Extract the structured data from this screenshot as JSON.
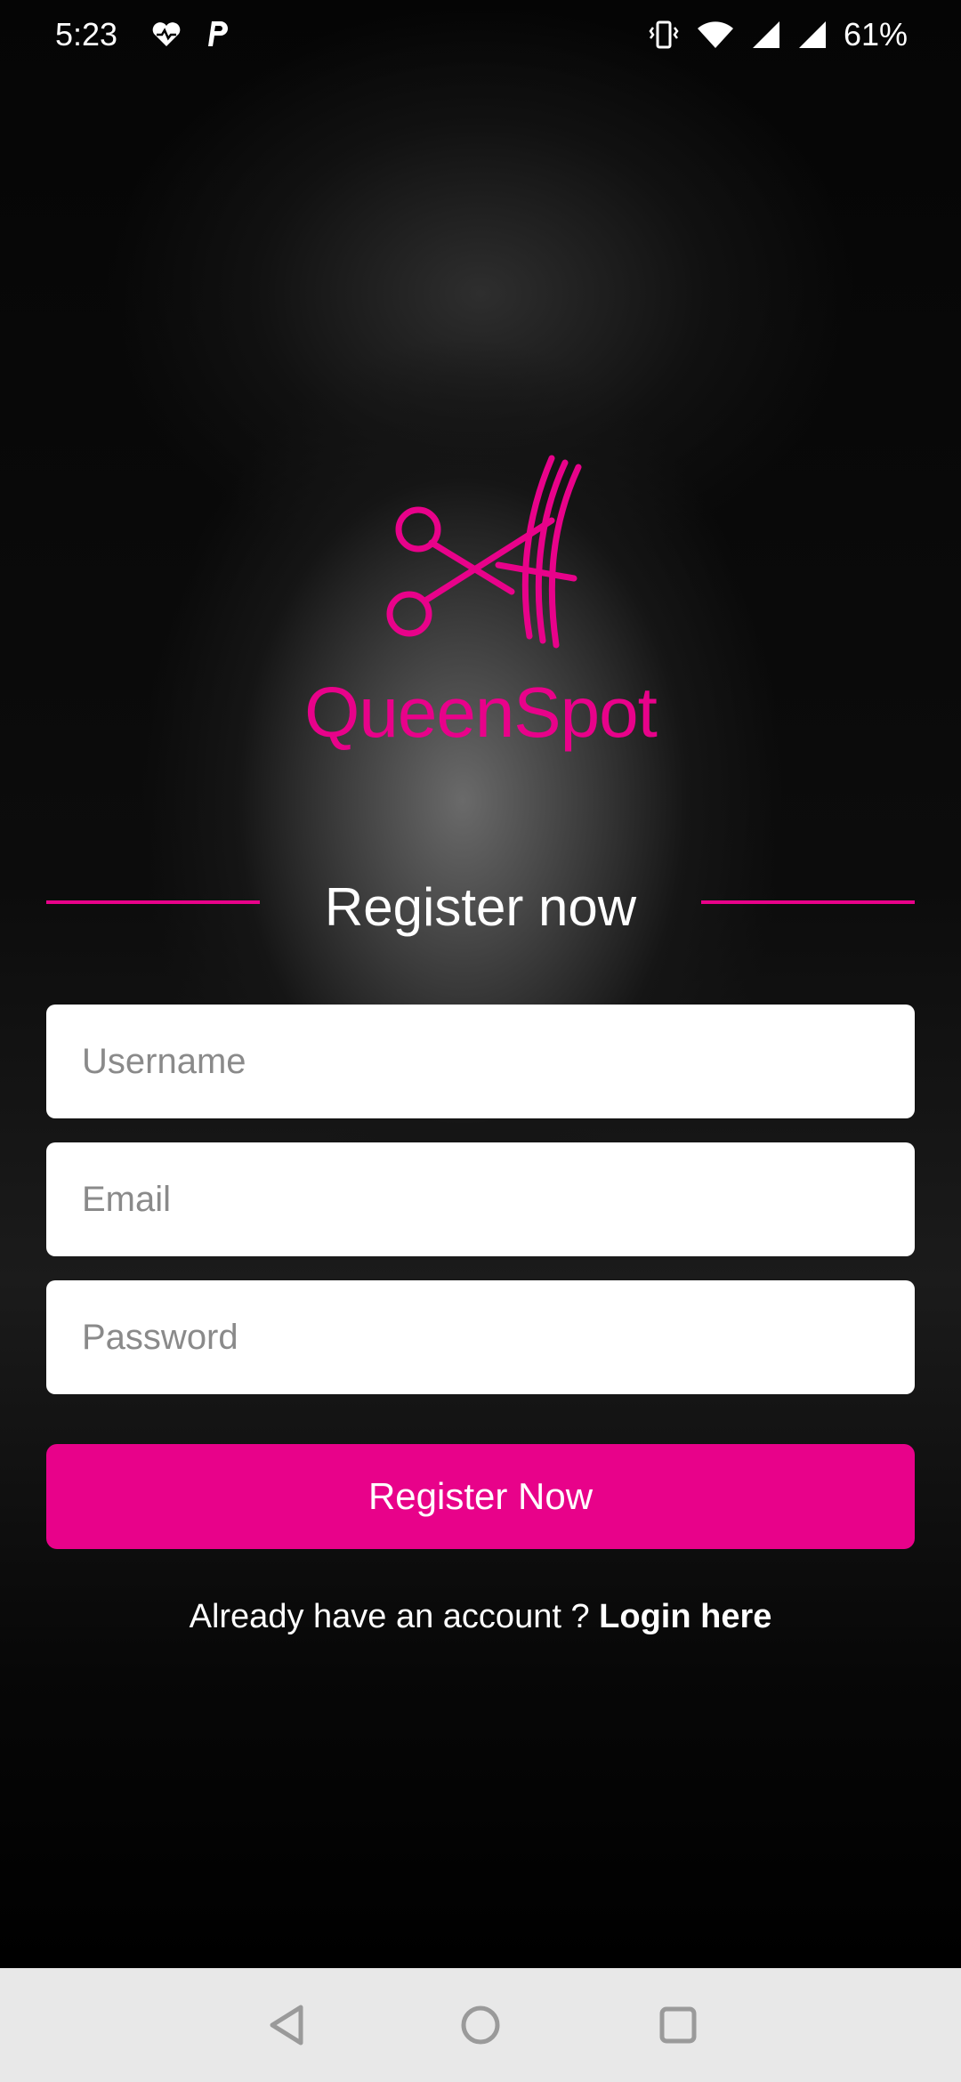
{
  "status_bar": {
    "time": "5:23",
    "battery": "61%",
    "icons": [
      "heart-pulse-icon",
      "p-icon",
      "vibrate-icon",
      "wifi-icon",
      "signal-icon",
      "signal-icon",
      "battery-text"
    ]
  },
  "brand": {
    "name": "QueenSpot",
    "logo_icon": "scissors-comb-icon",
    "accent_color": "#e8028a"
  },
  "register": {
    "heading": "Register now",
    "username_placeholder": "Username",
    "email_placeholder": "Email",
    "password_placeholder": "Password",
    "button_label": "Register Now",
    "login_prompt": "Already have an account ?",
    "login_link": "Login here"
  },
  "nav_bar": {
    "icons": [
      "back-icon",
      "home-icon",
      "recents-icon"
    ]
  }
}
